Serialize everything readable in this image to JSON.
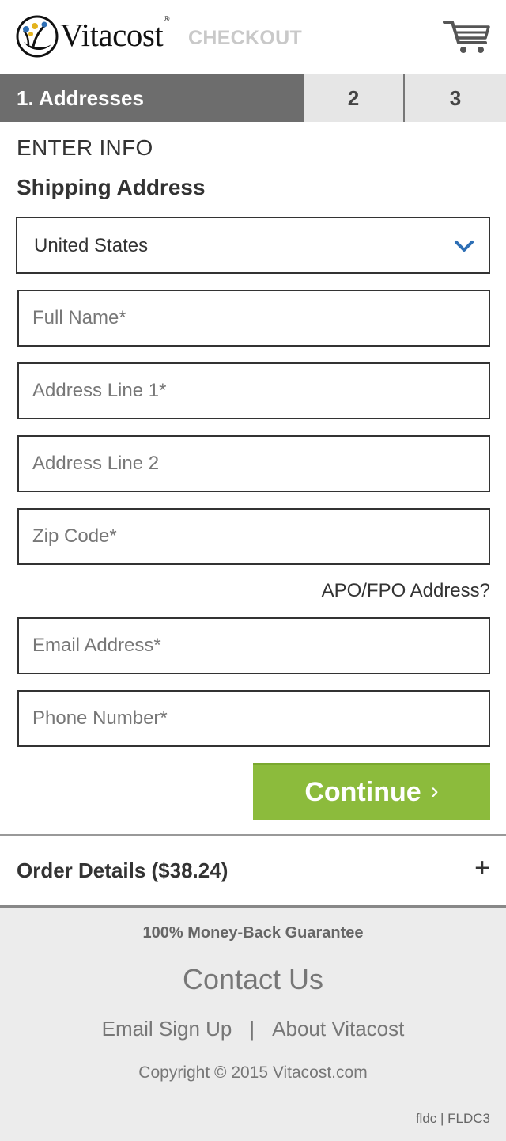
{
  "header": {
    "brand_name": "Vitacost",
    "brand_reg": "®",
    "checkout_label": "CHECKOUT",
    "cart_icon": "shopping-cart-icon"
  },
  "steps": {
    "active_label": "1. Addresses",
    "step2_label": "2",
    "step3_label": "3"
  },
  "form": {
    "section_label": "ENTER INFO",
    "title": "Shipping Address",
    "country": {
      "value": "United States",
      "icon": "chevron-down-icon",
      "icon_color": "#2e6fb5"
    },
    "full_name": {
      "placeholder": "Full Name*",
      "value": ""
    },
    "address1": {
      "placeholder": "Address Line 1*",
      "value": ""
    },
    "address2": {
      "placeholder": "Address Line 2",
      "value": ""
    },
    "zip": {
      "placeholder": "Zip Code*",
      "value": ""
    },
    "apo_link": "APO/FPO Address?",
    "email": {
      "placeholder": "Email Address*",
      "value": ""
    },
    "phone": {
      "placeholder": "Phone Number*",
      "value": ""
    },
    "continue_label": "Continue",
    "continue_arrow": "›",
    "continue_color": "#8cbb3c"
  },
  "order": {
    "title": "Order Details ($38.24)",
    "toggle": "+"
  },
  "footer": {
    "guarantee": "100% Money-Back Guarantee",
    "contact": "Contact Us",
    "email_signup": "Email Sign Up",
    "separator": "|",
    "about": "About Vitacost",
    "copyright": "Copyright © 2015 Vitacost.com",
    "build": "fldc | FLDC3"
  }
}
